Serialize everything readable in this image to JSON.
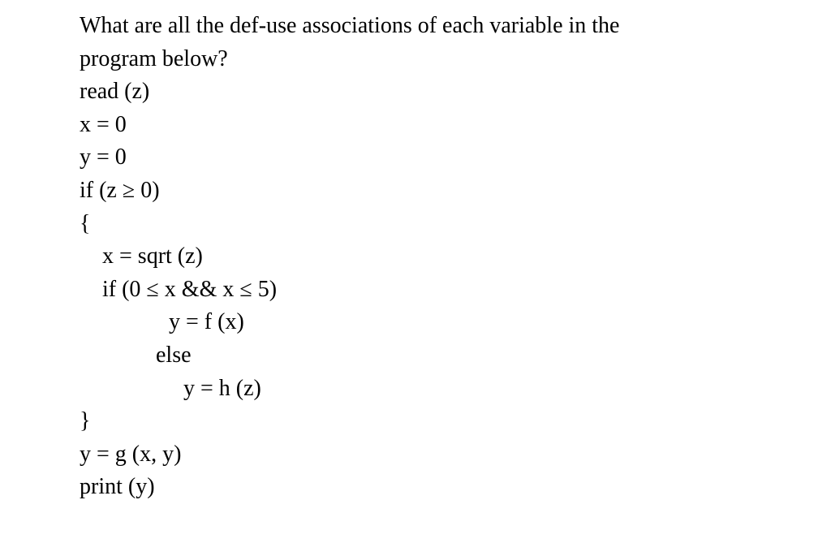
{
  "question": {
    "line1": "What are all the def-use associations of each variable in the",
    "line2": "program below?"
  },
  "code": {
    "l1": "read (z)",
    "l2": "x = 0",
    "l3": "y = 0",
    "l4": "if (z ≥ 0)",
    "l5": "{",
    "l6": "x = sqrt (z)",
    "l7": "if (0 ≤ x && x ≤ 5)",
    "l8": "y = f (x)",
    "l9": "else",
    "l10": "y = h (z)",
    "l11": "}",
    "l12": "y = g (x, y)",
    "l13": "print (y)"
  }
}
